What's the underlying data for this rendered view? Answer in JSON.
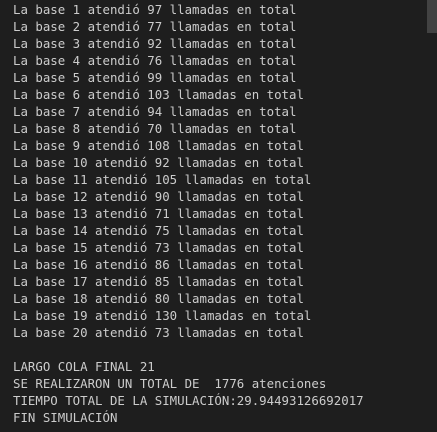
{
  "terminal": {
    "base_lines": [
      "La base 1 atendió 97 llamadas en total",
      "La base 2 atendió 77 llamadas en total",
      "La base 3 atendió 92 llamadas en total",
      "La base 4 atendió 76 llamadas en total",
      "La base 5 atendió 99 llamadas en total",
      "La base 6 atendió 103 llamadas en total",
      "La base 7 atendió 94 llamadas en total",
      "La base 8 atendió 70 llamadas en total",
      "La base 9 atendió 108 llamadas en total",
      "La base 10 atendió 92 llamadas en total",
      "La base 11 atendió 105 llamadas en total",
      "La base 12 atendió 90 llamadas en total",
      "La base 13 atendió 71 llamadas en total",
      "La base 14 atendió 75 llamadas en total",
      "La base 15 atendió 73 llamadas en total",
      "La base 16 atendió 86 llamadas en total",
      "La base 17 atendió 85 llamadas en total",
      "La base 18 atendió 80 llamadas en total",
      "La base 19 atendió 130 llamadas en total",
      "La base 20 atendió 73 llamadas en total"
    ],
    "summary": {
      "queue_length": "LARGO COLA FINAL 21",
      "total_attentions": "SE REALIZARON UN TOTAL DE  1776 atenciones",
      "total_time": "TIEMPO TOTAL DE LA SIMULACIÓN:29.94493126692017",
      "end": "FIN SIMULACIÓN"
    },
    "colors": {
      "background": "#1e1e1e",
      "text": "#cccccc"
    }
  }
}
